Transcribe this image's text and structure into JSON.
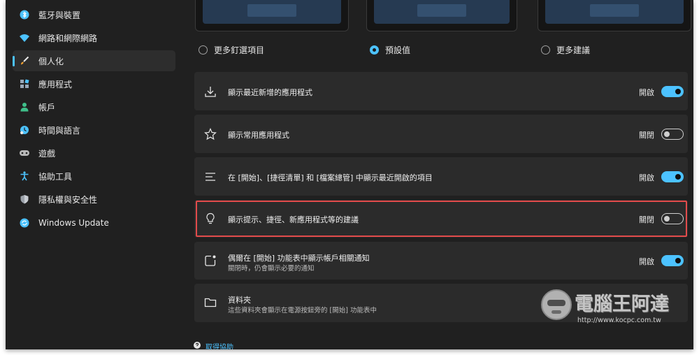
{
  "sidebar": {
    "items": [
      {
        "label": "藍牙與裝置",
        "icon": "bluetooth-icon",
        "color": "#4cc2ff"
      },
      {
        "label": "網路和網際網路",
        "icon": "wifi-icon",
        "color": "#4cc2ff"
      },
      {
        "label": "個人化",
        "icon": "brush-icon",
        "color": "#f0a030",
        "active": true
      },
      {
        "label": "應用程式",
        "icon": "apps-icon",
        "color": "#9aa8b8"
      },
      {
        "label": "帳戶",
        "icon": "account-icon",
        "color": "#3fbf8a"
      },
      {
        "label": "時間與語言",
        "icon": "clock-globe-icon",
        "color": "#4cc2ff"
      },
      {
        "label": "遊戲",
        "icon": "gamepad-icon",
        "color": "#b8b8b8"
      },
      {
        "label": "協助工具",
        "icon": "accessibility-icon",
        "color": "#4cc2ff"
      },
      {
        "label": "隱私權與安全性",
        "icon": "shield-icon",
        "color": "#9aa0a8"
      },
      {
        "label": "Windows Update",
        "icon": "update-icon",
        "color": "#4cc2ff"
      }
    ]
  },
  "layout_options": [
    {
      "label": "更多釘選項目",
      "selected": false
    },
    {
      "label": "預設值",
      "selected": true
    },
    {
      "label": "更多建議",
      "selected": false
    }
  ],
  "settings": [
    {
      "title": "顯示最近新增的應用程式",
      "state": "開啟",
      "on": true,
      "icon": "download-icon"
    },
    {
      "title": "顯示常用應用程式",
      "state": "關閉",
      "on": false,
      "icon": "star-icon"
    },
    {
      "title": "在 [開始]、[捷徑清單] 和 [檔案總管] 中顯示最近開啟的項目",
      "state": "開啟",
      "on": true,
      "icon": "list-icon"
    },
    {
      "title": "顯示提示、捷徑、新應用程式等的建議",
      "state": "關閉",
      "on": false,
      "icon": "lightbulb-icon"
    },
    {
      "title": "偶爾在 [開始] 功能表中顯示帳戶相關通知",
      "subtitle": "關閉時，仍會顯示必要的通知",
      "state": "開啟",
      "on": true,
      "icon": "notification-icon"
    },
    {
      "title": "資料夾",
      "subtitle": "這些資料夾會顯示在電源按鈕旁的 [開始] 功能表中",
      "icon": "folder-icon"
    }
  ],
  "help": {
    "label": "取得協助"
  },
  "watermark": {
    "text": "電腦王阿達",
    "url": "http://www.kocpc.com.tw"
  },
  "colors": {
    "accent": "#4cc2ff",
    "highlight": "#e24b4b",
    "background": "#202020",
    "card": "#2b2b2b"
  }
}
